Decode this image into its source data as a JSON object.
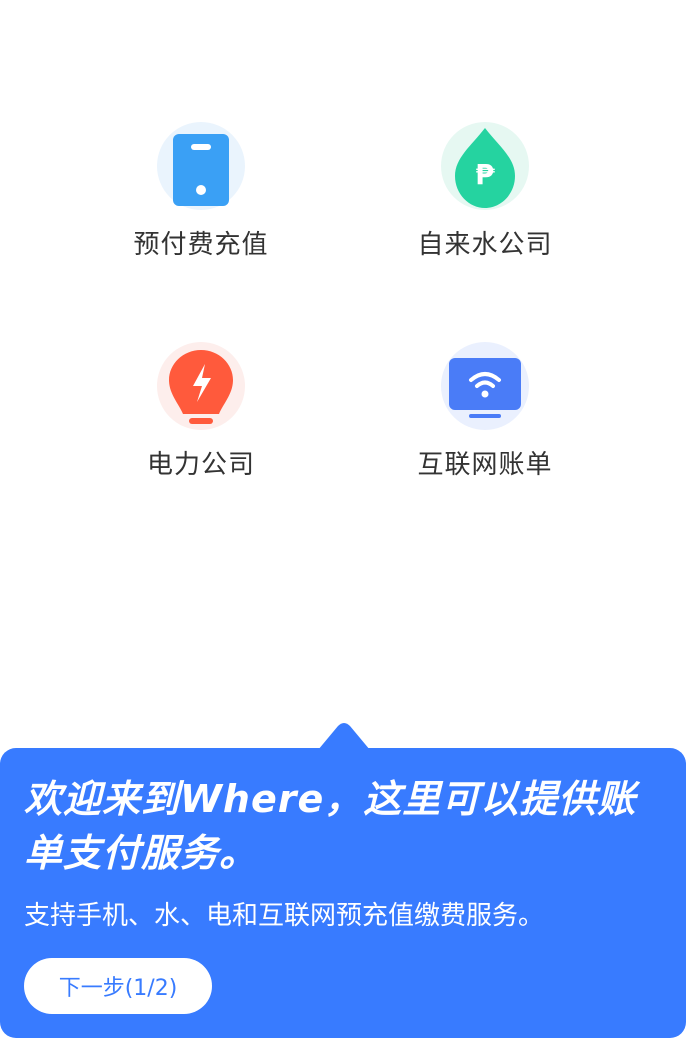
{
  "services": [
    {
      "label": "预付费充值",
      "icon": "prepaid-card-icon"
    },
    {
      "label": "自来水公司",
      "icon": "water-drop-icon",
      "symbol": "₱"
    },
    {
      "label": "电力公司",
      "icon": "lightbulb-bolt-icon"
    },
    {
      "label": "互联网账单",
      "icon": "wifi-monitor-icon"
    }
  ],
  "guide": {
    "title": "欢迎来到Where，这里可以提供账单支付服务。",
    "description": "支持手机、水、电和互联网预充值缴费服务。",
    "next_label": "下一步(1/2)"
  },
  "colors": {
    "accent": "#387bff",
    "blue_icon": "#3aa0f5",
    "green_icon": "#25d3a0",
    "red_icon": "#ff5a3c",
    "indigo_icon": "#4a7cf7",
    "text": "#333333"
  }
}
